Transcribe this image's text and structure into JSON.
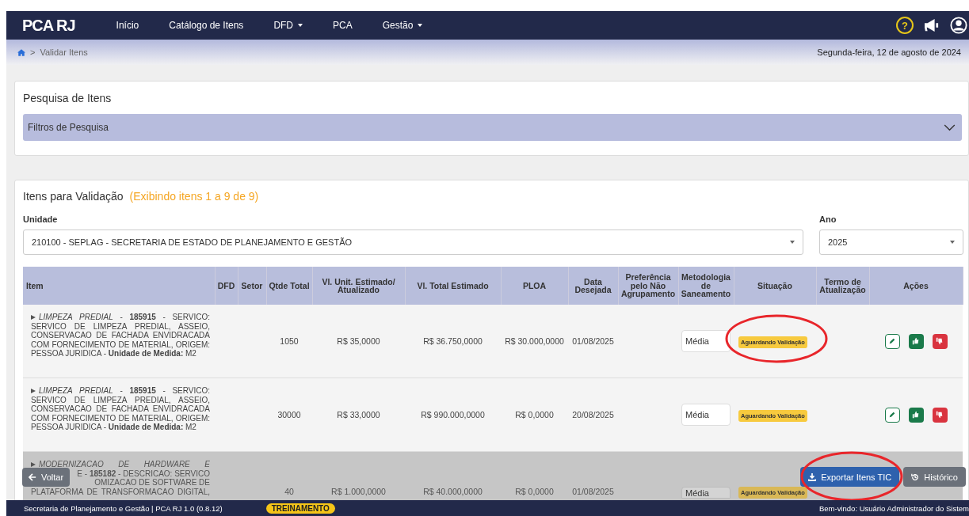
{
  "navbar": {
    "logo": "PCA RJ",
    "items": [
      {
        "label": "Início",
        "dropdown": false
      },
      {
        "label": "Catálogo de Itens",
        "dropdown": false
      },
      {
        "label": "DFD",
        "dropdown": true
      },
      {
        "label": "PCA",
        "dropdown": false
      },
      {
        "label": "Gestão",
        "dropdown": true
      }
    ],
    "help_icon": "?"
  },
  "breadcrumb": {
    "separator": ">",
    "current": "Validar Itens",
    "date": "Segunda-feira, 12 de agosto de 2024"
  },
  "search_card": {
    "title": "Pesquisa de Itens",
    "filters": {
      "label": "Filtros de Pesquisa",
      "expanded": false
    }
  },
  "items_card": {
    "title": "Itens para Validação",
    "subtitle": "(Exibindo itens 1 a 9 de 9)",
    "unit_label": "Unidade",
    "unit_value": "210100 - SEPLAG - SECRETARIA DE ESTADO DE PLANEJAMENTO E GESTÃO",
    "year_label": "Ano",
    "year_value": "2025"
  },
  "table": {
    "columns": [
      "Item",
      "DFD",
      "Setor",
      "Qtde Total",
      "Vl. Unit. Estimado/ Atualizado",
      "Vl. Total Estimado",
      "PLOA",
      "Data Desejada",
      "Preferência pelo Não Agrupamento",
      "Metodologia de Saneamento",
      "Situação",
      "Termo de Atualização",
      "Ações"
    ],
    "rows": [
      {
        "dimmed": false,
        "actions": true,
        "expanded": false,
        "item": "*LIMPEZA PREDIAL* - **185915** - SERVICO: SERVICO DE LIMPEZA PREDIAL, ASSEIO, CONSERVACAO DE FACHADA ENVIDRACADA COM FORNECIMENTO DE MATERIAL, ORIGEM: PESSOA JURIDICA - **Unidade de Medida:** M2",
        "qtde": "1050",
        "vl_unit": "R$ 35,0000",
        "vl_total": "R$ 36.750,0000",
        "ploa": "R$ 30.000,0000",
        "data": "01/08/2025",
        "metodologia": "Média",
        "situacao": "Aguardando Validação"
      },
      {
        "dimmed": false,
        "actions": true,
        "expanded": false,
        "item": "*LIMPEZA PREDIAL* - **185915** - SERVICO: SERVICO DE LIMPEZA PREDIAL, ASSEIO, CONSERVACAO DE FACHADA ENVIDRACADA COM FORNECIMENTO DE MATERIAL, ORIGEM: PESSOA JURIDICA - **Unidade de Medida:** M2",
        "qtde": "30000",
        "vl_unit": "R$ 33,0000",
        "vl_total": "R$ 990.000,0000",
        "ploa": "R$ 0,0000",
        "data": "20/08/2025",
        "metodologia": "Média",
        "situacao": "Aguardando Validação"
      },
      {
        "dimmed": true,
        "actions": false,
        "expanded": false,
        "item_lines": [
          "*MODERNIZACAO DE HARDWARE E*",
          "E - **185182** - DESCRICAO: SERVICO",
          "OMIZACAO DE SOFTWARE DE",
          "PLATAFORMA DE TRANSFORMACAO DIGITAL,"
        ],
        "qtde": "40",
        "vl_unit": "R$ 1.000,0000",
        "vl_total": "R$ 40.000,0000",
        "ploa": "R$ 0,0000",
        "data": "01/08/2025",
        "metodologia": "Média",
        "situacao": "Aguardando Validação"
      }
    ]
  },
  "action_bar": {
    "back": "Voltar",
    "export": "Exportar Itens TIC",
    "history": "Histórico"
  },
  "footer": {
    "text": "Secretaria de Planejamento e Gestão | PCA RJ 1.0 (0.8.12)",
    "badge": "TREINAMENTO",
    "welcome": "Bem-vindo: Usuário Administrador do Sistem"
  }
}
